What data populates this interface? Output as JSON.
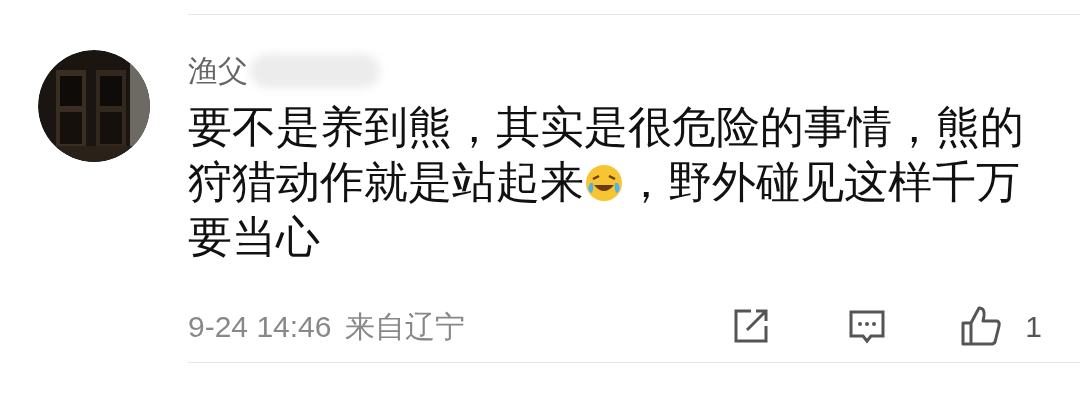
{
  "comment": {
    "username": "渔父",
    "body": [
      {
        "kind": "text",
        "text": "要不是养到熊，其实是很危险的事情，熊的狩猎动作就是站起来"
      },
      {
        "kind": "emoji"
      },
      {
        "kind": "text",
        "text": "，野外碰见这样千万要当心"
      }
    ],
    "time": "9-24 14:46",
    "location": "来自辽宁",
    "likes": "1"
  }
}
